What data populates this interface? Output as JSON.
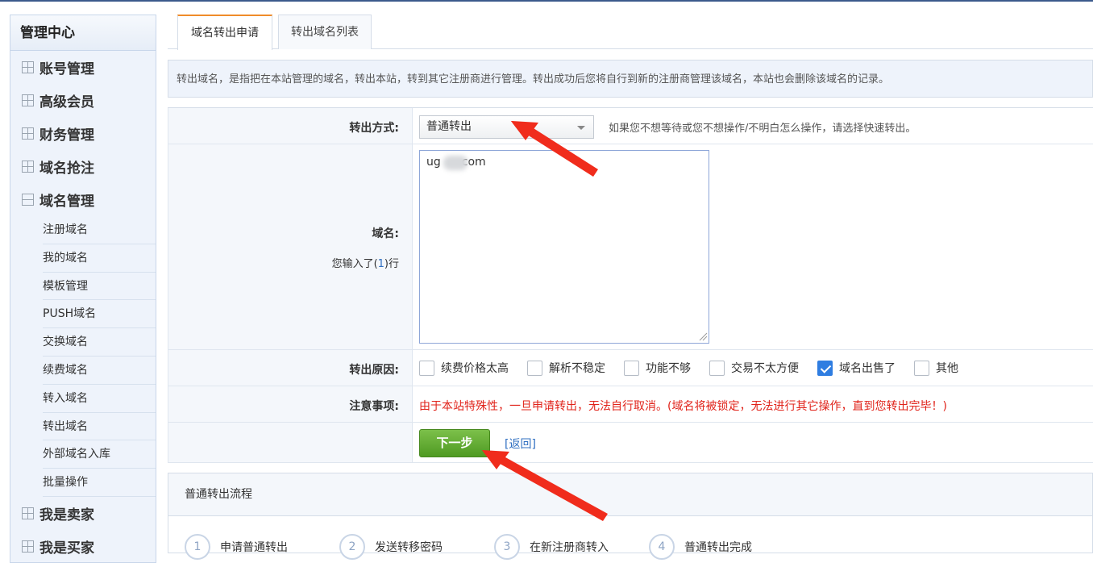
{
  "sidebar": {
    "title": "管理中心",
    "groups_top": [
      {
        "label": "账号管理"
      },
      {
        "label": "高级会员"
      },
      {
        "label": "财务管理"
      },
      {
        "label": "域名抢注"
      }
    ],
    "open_group": "域名管理",
    "sub_items": [
      "注册域名",
      "我的域名",
      "模板管理",
      "PUSH域名",
      "交换域名",
      "续费域名",
      "转入域名",
      "转出域名",
      "外部域名入库",
      "批量操作"
    ],
    "groups_bottom": [
      {
        "label": "我是卖家"
      },
      {
        "label": "我是买家"
      }
    ]
  },
  "tabs": [
    {
      "label": "域名转出申请",
      "active": true
    },
    {
      "label": "转出域名列表",
      "active": false
    }
  ],
  "info_text": "转出域名，是指把在本站管理的域名，转出本站，转到其它注册商进行管理。转出成功后您将自行到新的注册商管理该域名，本站也会删除该域名的记录。",
  "form": {
    "method_label": "转出方式:",
    "method_value": "普通转出",
    "method_hint": "如果您不想等待或您不想操作/不明白怎么操作，请选择快速转出。",
    "domain_label": "域名:",
    "lines_prefix": "您输入了(",
    "lines_count": "1",
    "lines_suffix": ")行",
    "domain_value_a": "ug",
    "domain_value_b": "com",
    "reason_label": "转出原因:",
    "reasons": [
      {
        "label": "续费价格太高",
        "checked": false
      },
      {
        "label": "解析不稳定",
        "checked": false
      },
      {
        "label": "功能不够",
        "checked": false
      },
      {
        "label": "交易不太方便",
        "checked": false
      },
      {
        "label": "域名出售了",
        "checked": true
      },
      {
        "label": "其他",
        "checked": false
      }
    ],
    "notice_label": "注意事项:",
    "notice_text": "由于本站特殊性，一旦申请转出，无法自行取消。(域名将被锁定，无法进行其它操作，直到您转出完毕！)",
    "next_button": "下一步",
    "back_link": "[返回]"
  },
  "process": {
    "title": "普通转出流程",
    "steps": [
      {
        "num": "1",
        "label": "申请普通转出"
      },
      {
        "num": "2",
        "label": "发送转移密码"
      },
      {
        "num": "3",
        "label": "在新注册商转入"
      },
      {
        "num": "4",
        "label": "普通转出完成"
      }
    ]
  },
  "colors": {
    "accent": "#f08c2a",
    "link": "#2f6fc1",
    "warning": "#e0231a",
    "button": "#5aa82c",
    "arrow": "#f02c1c"
  }
}
